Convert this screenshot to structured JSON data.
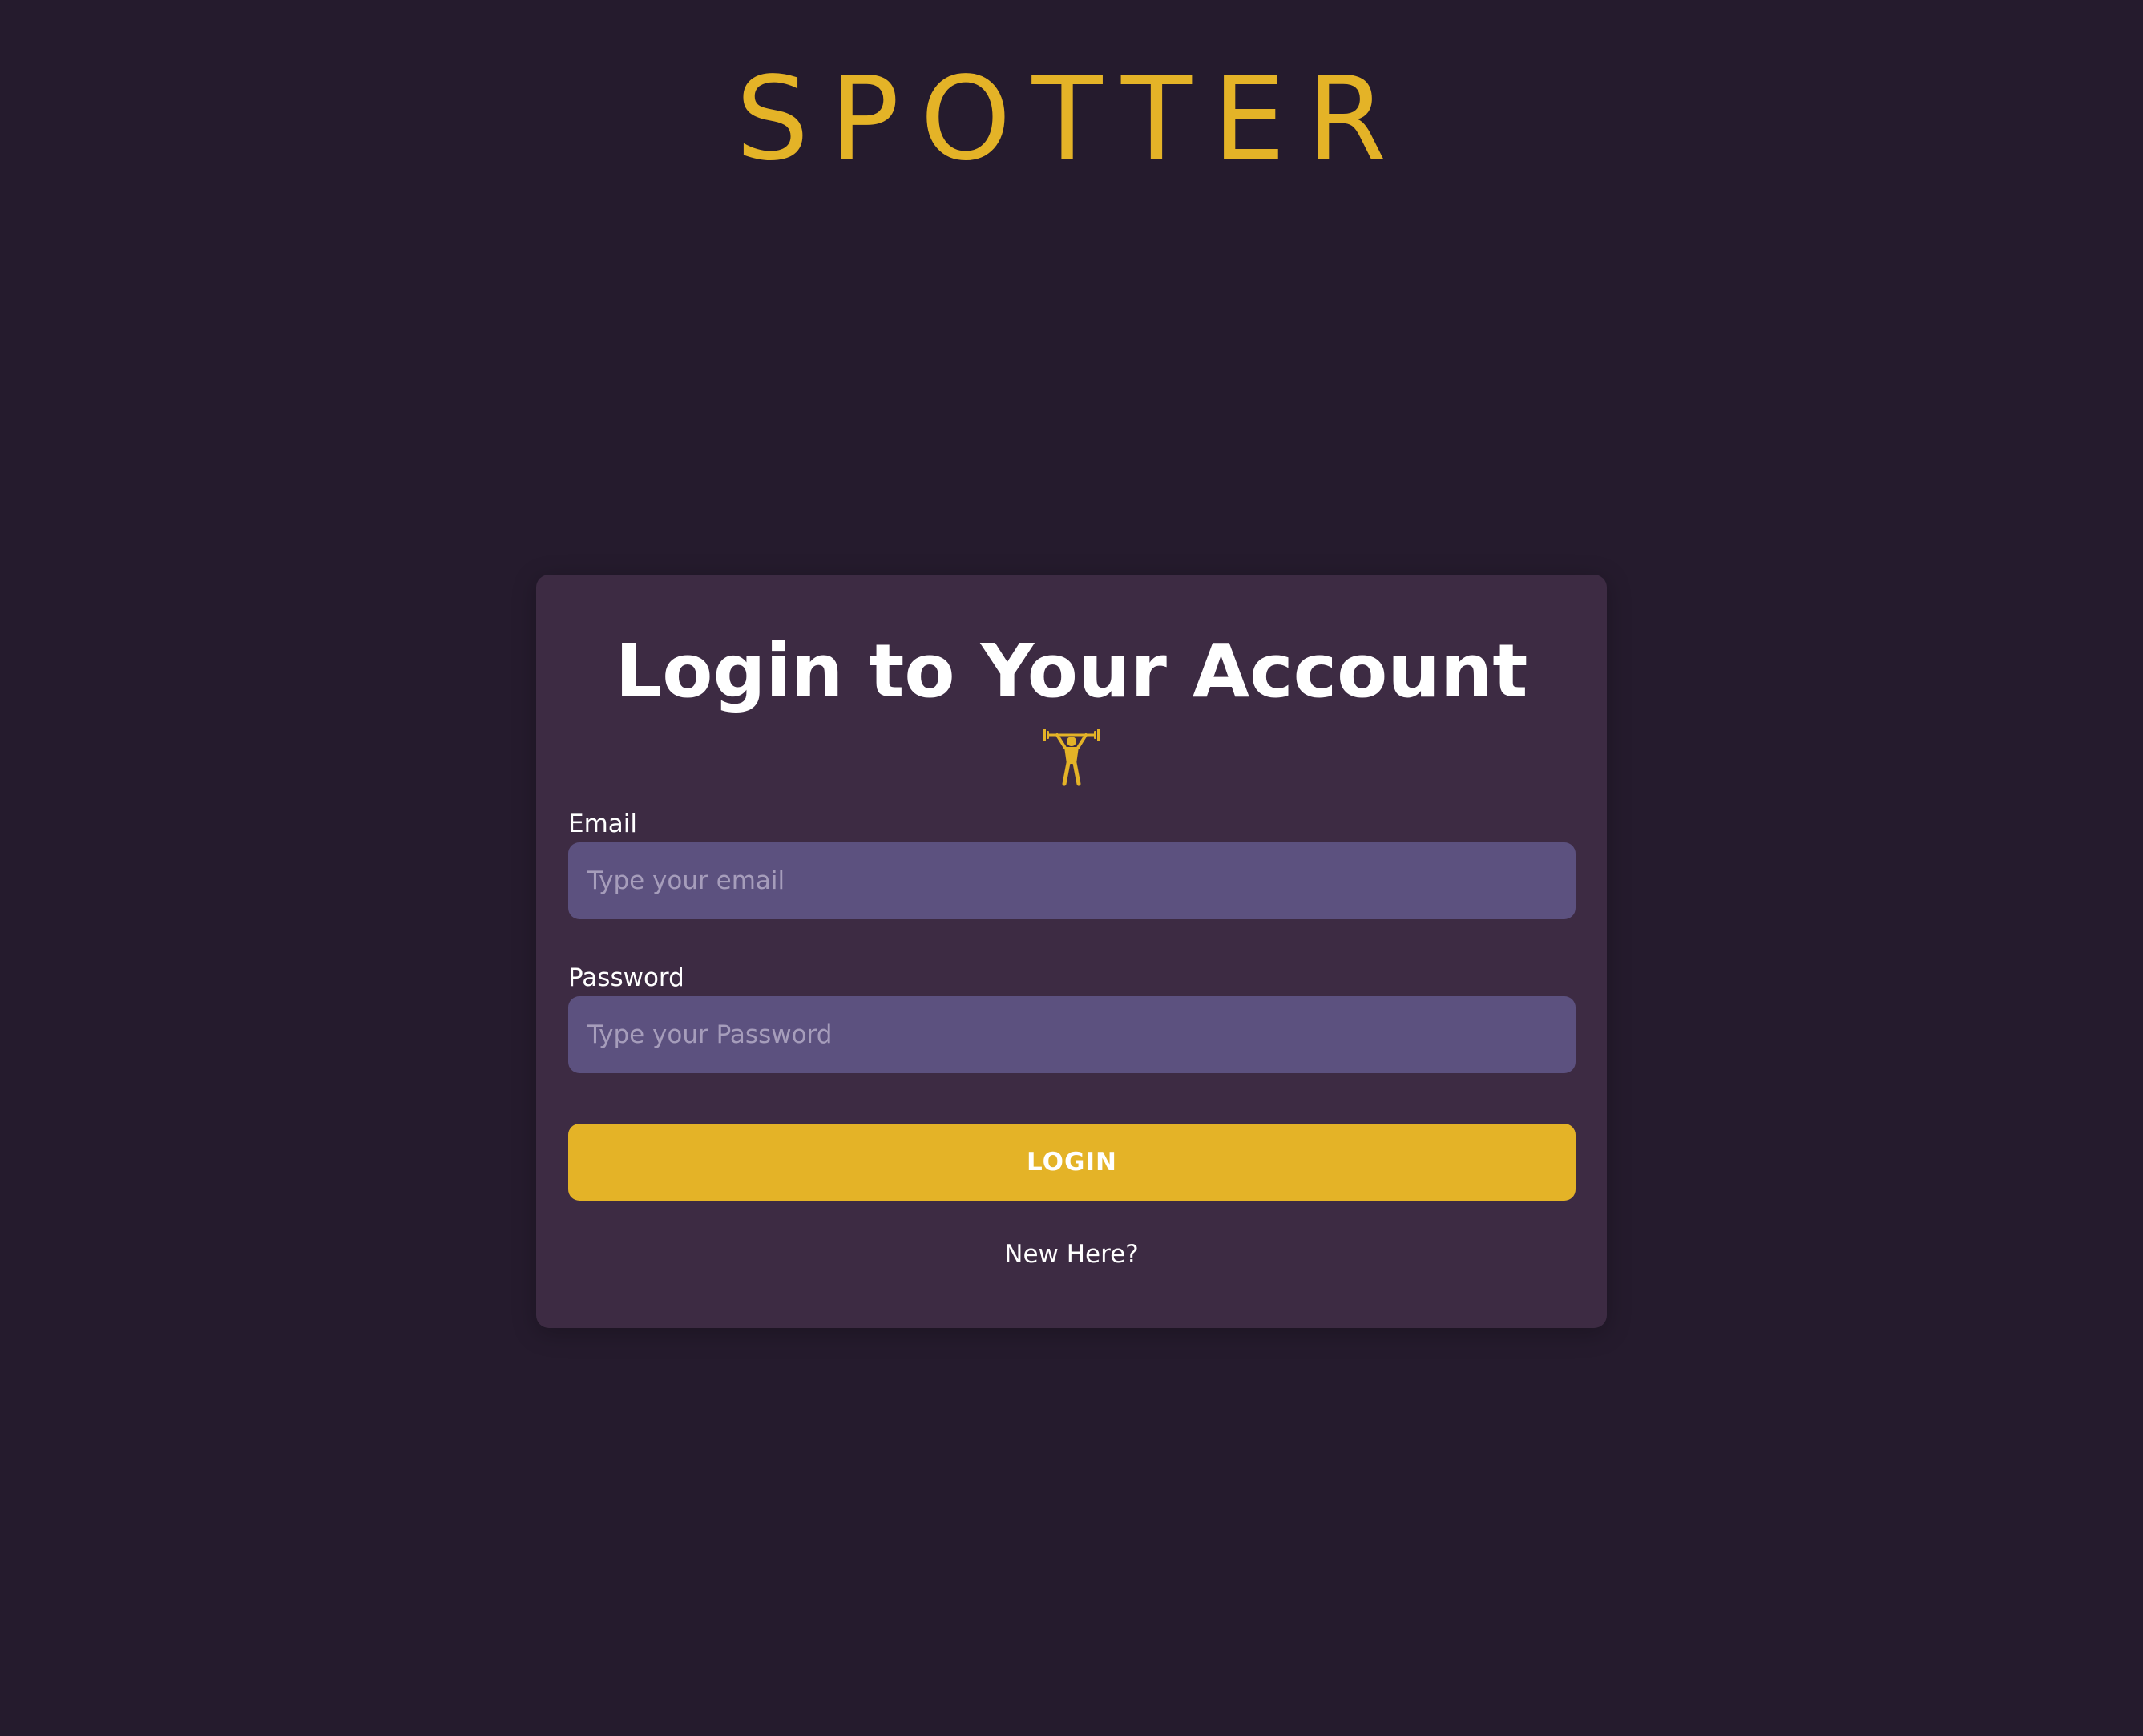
{
  "app": {
    "brand": "SPOTTER"
  },
  "login_card": {
    "title": "Login to Your Account",
    "icon": "weightlifter-icon",
    "email": {
      "label": "Email",
      "placeholder": "Type your email",
      "value": ""
    },
    "password": {
      "label": "Password",
      "placeholder": "Type your Password",
      "value": ""
    },
    "login_button_label": "LOGIN",
    "signup_link_label": "New Here?"
  },
  "colors": {
    "background": "#251b2d",
    "card": "#3d2b43",
    "accent": "#e4b327",
    "input_bg": "#5c517f",
    "text": "#ffffff",
    "placeholder": "#a69dbb"
  }
}
